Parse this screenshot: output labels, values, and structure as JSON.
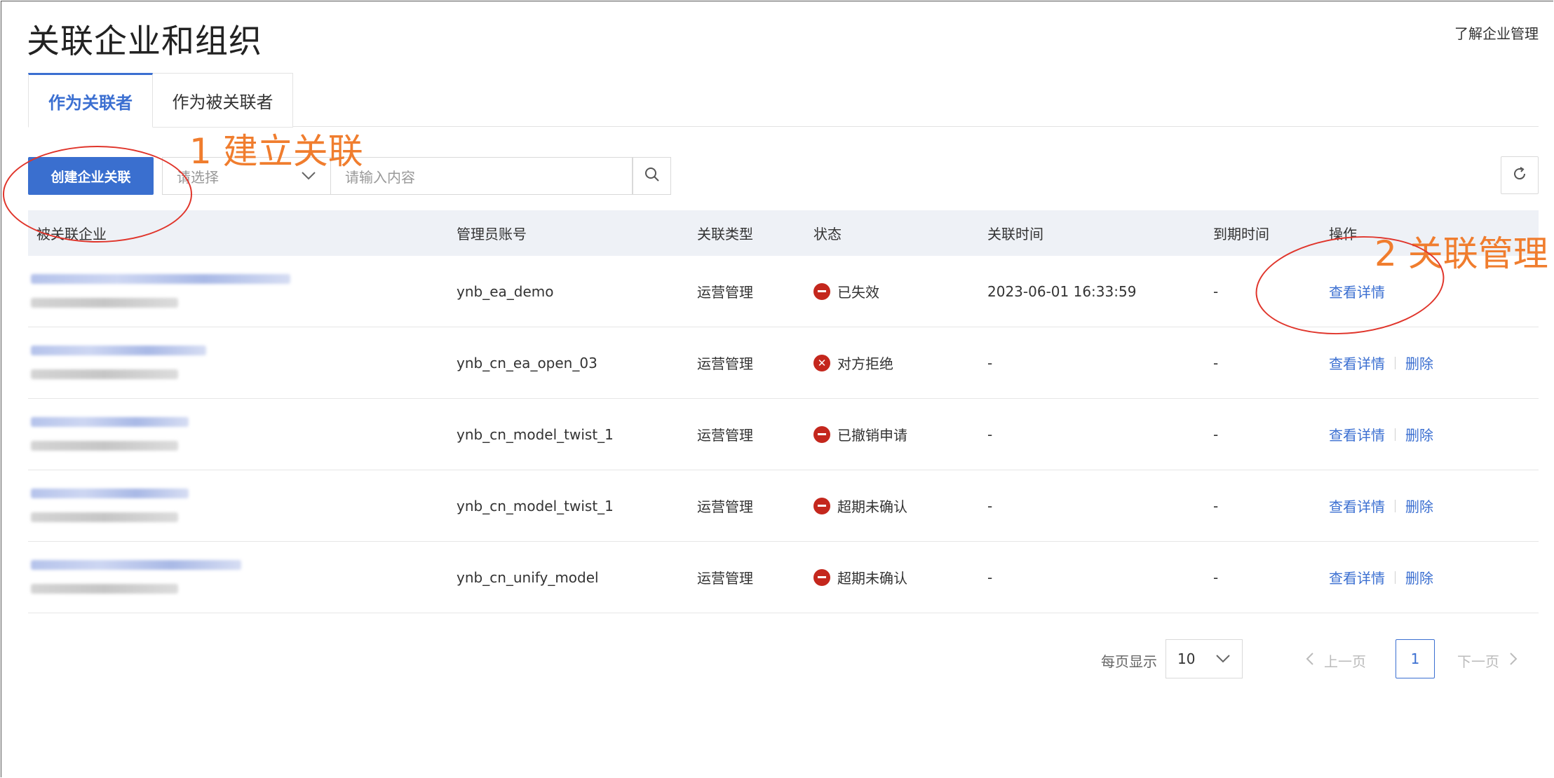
{
  "page": {
    "title": "关联企业和组织",
    "help_link": "了解企业管理"
  },
  "tabs": [
    {
      "label": "作为关联者",
      "active": true
    },
    {
      "label": "作为被关联者",
      "active": false
    }
  ],
  "toolbar": {
    "create_label": "创建企业关联",
    "select_placeholder": "请选择",
    "search_placeholder": "请输入内容"
  },
  "table": {
    "headers": [
      "被关联企业",
      "管理员账号",
      "关联类型",
      "状态",
      "关联时间",
      "到期时间",
      "操作"
    ],
    "rows": [
      {
        "account": "ynb_ea_demo",
        "type": "运营管理",
        "status": "已失效",
        "status_icon": "minus",
        "linked_time": "2023-06-01 16:33:59",
        "expire_time": "-",
        "ops": [
          "查看详情"
        ]
      },
      {
        "account": "ynb_cn_ea_open_03",
        "type": "运营管理",
        "status": "对方拒绝",
        "status_icon": "x",
        "linked_time": "-",
        "expire_time": "-",
        "ops": [
          "查看详情",
          "删除"
        ]
      },
      {
        "account": "ynb_cn_model_twist_1",
        "type": "运营管理",
        "status": "已撤销申请",
        "status_icon": "minus",
        "linked_time": "-",
        "expire_time": "-",
        "ops": [
          "查看详情",
          "删除"
        ]
      },
      {
        "account": "ynb_cn_model_twist_1",
        "type": "运营管理",
        "status": "超期未确认",
        "status_icon": "minus",
        "linked_time": "-",
        "expire_time": "-",
        "ops": [
          "查看详情",
          "删除"
        ]
      },
      {
        "account": "ynb_cn_unify_model",
        "type": "运营管理",
        "status": "超期未确认",
        "status_icon": "minus",
        "linked_time": "-",
        "expire_time": "-",
        "ops": [
          "查看详情",
          "删除"
        ]
      }
    ]
  },
  "pagination": {
    "page_size_label": "每页显示",
    "page_size": "10",
    "prev_label": "上一页",
    "current_page": "1",
    "next_label": "下一页"
  },
  "annotations": {
    "step1": "1 建立关联",
    "step2": "2 关联管理"
  },
  "colors": {
    "primary": "#3a6fcf",
    "status_error": "#c4271d",
    "annotation": "#f07d2e",
    "annotation_circle": "#e0352b"
  }
}
